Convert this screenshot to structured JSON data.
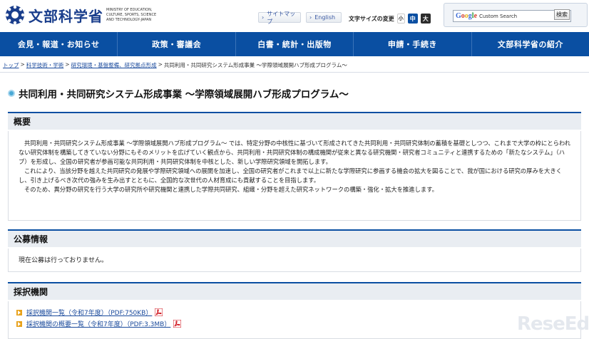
{
  "header": {
    "logo_name": "文部科学省",
    "logo_sub": "MINISTRY OF EDUCATION, CULTURE, SPORTS, SCIENCE AND TECHNOLOGY-JAPAN",
    "sitemap_label": "サイトマップ",
    "english_label": "English",
    "fontsize_label": "文字サイズの変更",
    "fontsize_small": "小",
    "fontsize_medium": "中",
    "fontsize_large": "大",
    "search": {
      "google": "Google",
      "placeholder": "Custom Search",
      "button": "検索"
    }
  },
  "nav": [
    {
      "label": "会見・報道・お知らせ"
    },
    {
      "label": "政策・審議会"
    },
    {
      "label": "白書・統計・出版物"
    },
    {
      "label": "申請・手続き"
    },
    {
      "label": "文部科学省の紹介"
    }
  ],
  "breadcrumb": [
    {
      "label": "トップ",
      "link": true
    },
    {
      "label": "科学技術・学術",
      "link": true
    },
    {
      "label": "研究環境・基盤整備、研究拠点形成",
      "link": true
    },
    {
      "label": "共同利用・共同研究システム形成事業 ～学際領域展開ハブ形成プログラム～",
      "link": false
    }
  ],
  "page_title": "共同利用・共同研究システム形成事業 ～学際領域展開ハブ形成プログラム～",
  "sections": {
    "overview": {
      "heading": "概要",
      "paragraphs": [
        "共同利用・共同研究システム形成事業 ～学際領域展開ハブ形成プログラム～ では、特定分野の中核性に基づいて形成されてきた共同利用・共同研究体制の蓄積を基礎としつつ、これまで大学の枠にとらわれない研究体制を構築してきていない分野にもそのメリットを広げていく観点から、共同利用・共同研究体制の構成機関が従来と異なる研究機関・研究者コミュニティと連携するための「新たなシステム」（ハブ）を形成し、全国の研究者が参画可能な共同利用・共同研究体制を中核とした、新しい学際研究領域を開拓します。",
        "これにより、当該分野を越えた共同研究の発展や学際研究領域への展開を加速し、全国の研究者がこれまで以上に新たな学際研究に参画する機会の拡大を図ることで、我が国における研究の厚みを大きくし、引き上げるべき次代の強みを生み出すとともに、全国的な次世代の人材育成にも貢献することを目指します。",
        "そのため、異分野の研究を行う大学の研究所や研究機関と連携した学際共同研究、組織・分野を超えた研究ネットワークの構築・強化・拡大を推進します。"
      ]
    },
    "recruit": {
      "heading": "公募情報",
      "text": "現在公募は行っておりません。"
    },
    "adopted": {
      "heading": "採択機関",
      "items": [
        {
          "label": "採択機関一覧（令和7年度）（PDF:750KB）"
        },
        {
          "label": "採択機関の概要一覧（令和7年度）（PDF:3.3MB）"
        }
      ]
    }
  },
  "watermark": "ReseEd",
  "colors": {
    "nav_bg": "#0a4fa2",
    "link": "#1a4a9c",
    "title_dot": "#4aa9d6",
    "pdf_arrow": "#e8a21c",
    "pdf_icon": "#d0121b"
  }
}
